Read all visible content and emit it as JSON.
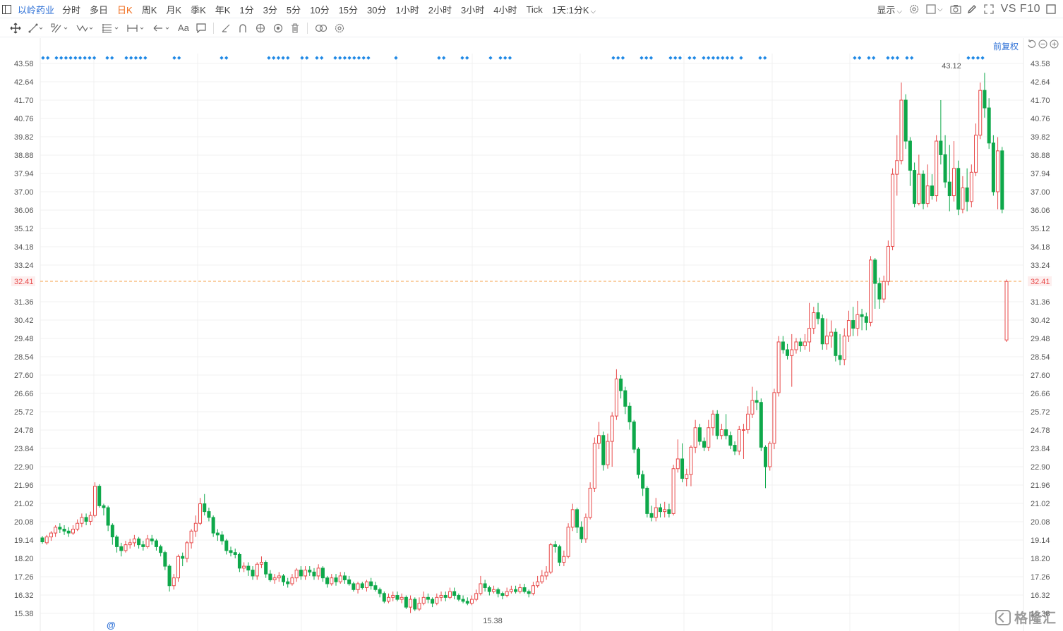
{
  "topbar": {
    "stock_name": "以岭药业",
    "tabs": [
      "分时",
      "多日",
      "日K",
      "周K",
      "月K",
      "季K",
      "年K",
      "1分",
      "3分",
      "5分",
      "10分",
      "15分",
      "30分",
      "1小时",
      "2小时",
      "3小时",
      "4小时",
      "Tick",
      "1天:1分K"
    ],
    "active_tab": "日K",
    "display_label": "显示",
    "vs_label": "VS",
    "f10_label": "F10"
  },
  "toolbar": {
    "icons": [
      "move-icon",
      "line-icon",
      "channel-icon",
      "wave-icon",
      "fib-icon",
      "measure-icon",
      "arrow-icon",
      "text-icon",
      "note-icon",
      "brush-icon",
      "magnet-icon",
      "visibility-icon",
      "lock-icon",
      "trash-icon",
      "compare-icon",
      "settings-icon"
    ],
    "text_tool_label": "Aa"
  },
  "chart": {
    "adjust_label": "前复权",
    "current_price": 32.41,
    "current_price_label": "32.41",
    "high_label": "43.12",
    "low_label": "15.38",
    "y_ticks": [
      "43.58",
      "42.64",
      "41.70",
      "40.76",
      "39.82",
      "38.88",
      "37.94",
      "37.00",
      "36.06",
      "35.12",
      "34.18",
      "33.24",
      "32.41",
      "31.36",
      "30.42",
      "29.48",
      "28.54",
      "27.60",
      "26.66",
      "25.72",
      "24.78",
      "23.84",
      "22.90",
      "21.96",
      "21.02",
      "20.08",
      "19.14",
      "18.20",
      "17.26",
      "16.32",
      "15.38"
    ],
    "colors": {
      "up": "#e84a4a",
      "down": "#0ea84a",
      "price_line": "#f5a04a",
      "price_label": "#e84a4a",
      "marker": "#1e88e5",
      "grid": "#f0f0f0",
      "axis_text": "#555"
    },
    "marker_glyph": "◆"
  },
  "chart_data": {
    "type": "candlestick",
    "title": "以岭药业 日K",
    "y_range": [
      15.38,
      43.58
    ],
    "candles": [
      [
        19.25,
        19.05,
        19.35,
        18.95
      ],
      [
        19.0,
        19.3,
        19.4,
        18.9
      ],
      [
        19.3,
        19.5,
        19.6,
        19.1
      ],
      [
        19.5,
        19.8,
        19.9,
        19.3
      ],
      [
        19.8,
        19.7,
        20.0,
        19.5
      ],
      [
        19.7,
        19.6,
        19.9,
        19.4
      ],
      [
        19.6,
        19.5,
        19.8,
        19.3
      ],
      [
        19.5,
        19.7,
        19.9,
        19.4
      ],
      [
        19.7,
        20.0,
        20.2,
        19.6
      ],
      [
        20.0,
        20.3,
        20.5,
        19.8
      ],
      [
        20.3,
        20.1,
        20.5,
        19.9
      ],
      [
        20.1,
        20.4,
        20.6,
        19.9
      ],
      [
        20.4,
        21.9,
        22.1,
        20.3
      ],
      [
        21.9,
        20.9,
        22.0,
        20.8
      ],
      [
        20.9,
        20.8,
        21.0,
        20.4
      ],
      [
        20.8,
        19.9,
        20.9,
        19.6
      ],
      [
        19.9,
        19.3,
        20.0,
        18.9
      ],
      [
        19.3,
        18.8,
        19.4,
        18.5
      ],
      [
        18.8,
        18.6,
        19.0,
        18.3
      ],
      [
        18.6,
        18.9,
        19.1,
        18.5
      ],
      [
        18.9,
        19.0,
        19.2,
        18.7
      ],
      [
        19.0,
        19.2,
        19.4,
        18.8
      ],
      [
        19.2,
        18.9,
        19.3,
        18.7
      ],
      [
        18.9,
        18.8,
        19.1,
        18.6
      ],
      [
        18.8,
        19.2,
        19.4,
        18.7
      ],
      [
        19.2,
        19.1,
        19.4,
        18.9
      ],
      [
        19.1,
        18.8,
        19.2,
        18.6
      ],
      [
        18.8,
        18.5,
        18.9,
        18.3
      ],
      [
        18.5,
        17.8,
        18.6,
        17.6
      ],
      [
        17.8,
        16.8,
        17.9,
        16.5
      ],
      [
        16.8,
        17.2,
        17.4,
        16.6
      ],
      [
        17.2,
        18.3,
        18.4,
        17.0
      ],
      [
        18.3,
        18.2,
        18.5,
        17.8
      ],
      [
        18.2,
        19.0,
        19.1,
        18.0
      ],
      [
        19.0,
        19.6,
        19.7,
        18.7
      ],
      [
        19.6,
        20.0,
        20.4,
        19.3
      ],
      [
        20.0,
        21.0,
        21.3,
        19.9
      ],
      [
        21.0,
        20.6,
        21.5,
        20.4
      ],
      [
        20.6,
        20.3,
        20.8,
        20.1
      ],
      [
        20.3,
        19.5,
        20.4,
        19.3
      ],
      [
        19.5,
        19.4,
        19.7,
        19.1
      ],
      [
        19.4,
        19.1,
        19.6,
        18.9
      ],
      [
        19.1,
        18.6,
        19.2,
        18.4
      ],
      [
        18.6,
        18.5,
        18.8,
        18.3
      ],
      [
        18.5,
        18.4,
        18.7,
        18.2
      ],
      [
        18.4,
        17.7,
        18.5,
        17.5
      ],
      [
        17.7,
        17.8,
        18.0,
        17.5
      ],
      [
        17.8,
        17.6,
        18.0,
        17.3
      ],
      [
        17.6,
        17.3,
        17.8,
        17.1
      ],
      [
        17.3,
        17.9,
        18.0,
        17.1
      ],
      [
        17.9,
        18.0,
        18.3,
        17.7
      ],
      [
        18.0,
        17.4,
        18.1,
        17.2
      ],
      [
        17.4,
        17.1,
        17.6,
        17.0
      ],
      [
        17.1,
        17.2,
        17.4,
        16.9
      ],
      [
        17.2,
        17.3,
        17.5,
        17.0
      ],
      [
        17.3,
        17.0,
        17.4,
        16.8
      ],
      [
        17.0,
        16.9,
        17.2,
        16.7
      ],
      [
        16.9,
        17.2,
        17.4,
        16.8
      ],
      [
        17.2,
        17.6,
        17.7,
        17.0
      ],
      [
        17.6,
        17.3,
        17.8,
        17.1
      ],
      [
        17.3,
        17.6,
        17.8,
        17.1
      ],
      [
        17.6,
        17.5,
        17.8,
        17.3
      ],
      [
        17.5,
        17.3,
        17.7,
        17.1
      ],
      [
        17.3,
        17.7,
        17.9,
        17.1
      ],
      [
        17.7,
        17.2,
        17.8,
        17.0
      ],
      [
        17.2,
        16.9,
        17.3,
        16.7
      ],
      [
        16.9,
        17.2,
        17.4,
        16.8
      ],
      [
        17.2,
        17.0,
        17.4,
        16.8
      ],
      [
        17.0,
        17.3,
        17.5,
        16.9
      ],
      [
        17.3,
        17.1,
        17.5,
        16.9
      ],
      [
        17.1,
        16.9,
        17.3,
        16.8
      ],
      [
        16.9,
        16.6,
        17.0,
        16.5
      ],
      [
        16.6,
        16.9,
        17.0,
        16.4
      ],
      [
        16.9,
        16.7,
        17.0,
        16.6
      ],
      [
        16.7,
        17.0,
        17.1,
        16.5
      ],
      [
        17.0,
        16.8,
        17.2,
        16.6
      ],
      [
        16.8,
        16.6,
        17.0,
        16.5
      ],
      [
        16.6,
        16.4,
        16.7,
        16.2
      ],
      [
        16.4,
        16.0,
        16.5,
        15.9
      ],
      [
        16.0,
        16.2,
        16.4,
        15.9
      ],
      [
        16.2,
        16.3,
        16.5,
        16.0
      ],
      [
        16.3,
        16.1,
        16.5,
        16.0
      ],
      [
        16.1,
        16.2,
        16.4,
        15.9
      ],
      [
        16.2,
        15.7,
        16.3,
        15.6
      ],
      [
        15.7,
        16.1,
        16.3,
        15.4
      ],
      [
        16.1,
        15.6,
        16.2,
        15.5
      ],
      [
        15.6,
        15.9,
        16.2,
        15.5
      ],
      [
        15.9,
        16.2,
        16.5,
        15.8
      ],
      [
        16.2,
        16.1,
        16.4,
        15.9
      ],
      [
        16.1,
        15.9,
        16.2,
        15.7
      ],
      [
        15.9,
        16.2,
        16.4,
        15.8
      ],
      [
        16.2,
        16.3,
        16.5,
        16.0
      ],
      [
        16.3,
        16.2,
        16.5,
        16.0
      ],
      [
        16.2,
        16.5,
        16.7,
        16.1
      ],
      [
        16.5,
        16.3,
        16.7,
        16.1
      ],
      [
        16.3,
        16.1,
        16.4,
        16.0
      ],
      [
        16.1,
        16.0,
        16.3,
        15.9
      ],
      [
        16.0,
        15.9,
        16.2,
        15.8
      ],
      [
        15.9,
        16.1,
        16.3,
        15.8
      ],
      [
        16.1,
        16.4,
        16.6,
        16.0
      ],
      [
        16.4,
        16.9,
        17.3,
        16.3
      ],
      [
        16.9,
        16.7,
        17.1,
        16.5
      ],
      [
        16.7,
        16.5,
        16.8,
        16.3
      ],
      [
        16.5,
        16.6,
        16.8,
        16.4
      ],
      [
        16.6,
        16.4,
        16.7,
        16.2
      ],
      [
        16.4,
        16.3,
        16.5,
        16.1
      ],
      [
        16.3,
        16.5,
        16.7,
        16.2
      ],
      [
        16.5,
        16.6,
        16.8,
        16.4
      ],
      [
        16.6,
        16.5,
        16.8,
        16.4
      ],
      [
        16.5,
        16.7,
        16.9,
        16.4
      ],
      [
        16.7,
        16.5,
        16.9,
        16.4
      ],
      [
        16.5,
        16.4,
        16.6,
        16.2
      ],
      [
        16.4,
        16.8,
        17.0,
        16.3
      ],
      [
        16.8,
        17.0,
        17.3,
        16.7
      ],
      [
        17.0,
        17.3,
        17.6,
        16.9
      ],
      [
        17.3,
        17.5,
        17.8,
        17.1
      ],
      [
        17.5,
        18.9,
        19.0,
        17.4
      ],
      [
        18.9,
        18.8,
        19.1,
        18.5
      ],
      [
        18.8,
        18.0,
        18.9,
        17.8
      ],
      [
        18.0,
        18.3,
        18.6,
        17.8
      ],
      [
        18.3,
        19.8,
        20.0,
        18.2
      ],
      [
        19.8,
        20.7,
        21.0,
        19.6
      ],
      [
        20.7,
        19.8,
        20.8,
        19.5
      ],
      [
        19.8,
        19.2,
        20.1,
        19.0
      ],
      [
        19.2,
        20.3,
        20.5,
        19.0
      ],
      [
        20.3,
        21.8,
        22.1,
        20.2
      ],
      [
        21.8,
        24.1,
        24.4,
        21.6
      ],
      [
        24.1,
        24.5,
        25.2,
        23.8
      ],
      [
        24.5,
        23.0,
        24.7,
        22.7
      ],
      [
        23.0,
        24.2,
        24.6,
        22.8
      ],
      [
        24.2,
        25.5,
        25.7,
        22.9
      ],
      [
        25.5,
        27.4,
        27.9,
        25.3
      ],
      [
        27.4,
        26.8,
        27.6,
        26.4
      ],
      [
        26.8,
        26.0,
        27.0,
        25.6
      ],
      [
        26.0,
        25.2,
        26.2,
        24.8
      ],
      [
        25.2,
        23.8,
        25.3,
        23.6
      ],
      [
        23.8,
        22.5,
        23.9,
        22.3
      ],
      [
        22.5,
        21.8,
        22.7,
        21.4
      ],
      [
        21.8,
        20.5,
        21.9,
        20.3
      ],
      [
        20.5,
        20.3,
        20.9,
        20.1
      ],
      [
        20.3,
        20.8,
        21.3,
        20.1
      ],
      [
        20.8,
        20.6,
        21.0,
        20.3
      ],
      [
        20.6,
        20.7,
        21.1,
        20.3
      ],
      [
        20.7,
        20.5,
        21.0,
        20.3
      ],
      [
        20.5,
        22.8,
        23.0,
        20.4
      ],
      [
        22.8,
        23.3,
        24.3,
        22.6
      ],
      [
        23.3,
        22.3,
        24.1,
        22.1
      ],
      [
        22.3,
        22.5,
        22.8,
        21.9
      ],
      [
        22.5,
        23.9,
        24.0,
        21.9
      ],
      [
        23.9,
        24.9,
        25.3,
        23.6
      ],
      [
        24.9,
        24.2,
        25.1,
        24.0
      ],
      [
        24.2,
        23.9,
        24.4,
        23.7
      ],
      [
        23.9,
        24.9,
        25.3,
        23.7
      ],
      [
        24.9,
        25.6,
        25.8,
        24.5
      ],
      [
        25.6,
        24.5,
        25.8,
        24.3
      ],
      [
        24.5,
        24.8,
        25.1,
        24.3
      ],
      [
        24.8,
        24.5,
        25.6,
        24.3
      ],
      [
        24.5,
        24.0,
        24.7,
        23.8
      ],
      [
        24.0,
        23.7,
        24.2,
        23.5
      ],
      [
        23.7,
        24.8,
        25.0,
        23.5
      ],
      [
        24.8,
        24.8,
        25.1,
        23.3
      ],
      [
        24.8,
        25.6,
        26.0,
        24.6
      ],
      [
        25.6,
        26.3,
        27.0,
        25.4
      ],
      [
        26.3,
        26.2,
        26.8,
        25.8
      ],
      [
        26.2,
        23.9,
        26.4,
        23.7
      ],
      [
        23.9,
        22.9,
        24.0,
        21.8
      ],
      [
        22.9,
        24.1,
        24.2,
        22.7
      ],
      [
        24.1,
        26.7,
        26.9,
        23.8
      ],
      [
        26.7,
        29.3,
        29.6,
        26.5
      ],
      [
        29.3,
        28.9,
        29.6,
        28.7
      ],
      [
        28.9,
        28.6,
        29.2,
        28.4
      ],
      [
        28.6,
        28.9,
        29.7,
        27.0
      ],
      [
        28.9,
        29.3,
        29.5,
        28.7
      ],
      [
        29.3,
        29.1,
        29.5,
        28.8
      ],
      [
        29.1,
        29.3,
        29.7,
        28.9
      ],
      [
        29.3,
        30.0,
        31.3,
        28.8
      ],
      [
        30.0,
        30.8,
        31.1,
        29.7
      ],
      [
        30.8,
        30.5,
        31.3,
        30.2
      ],
      [
        30.5,
        29.2,
        30.7,
        28.9
      ],
      [
        29.2,
        29.6,
        30.5,
        28.9
      ],
      [
        29.6,
        29.8,
        30.4,
        29.0
      ],
      [
        29.8,
        28.6,
        30.0,
        28.3
      ],
      [
        28.6,
        28.4,
        29.7,
        28.1
      ],
      [
        28.4,
        29.6,
        30.0,
        28.1
      ],
      [
        29.6,
        30.4,
        30.9,
        29.3
      ],
      [
        30.4,
        30.0,
        31.1,
        29.6
      ],
      [
        30.0,
        30.7,
        31.4,
        29.6
      ],
      [
        30.7,
        30.6,
        31.0,
        29.9
      ],
      [
        30.6,
        30.3,
        30.8,
        29.9
      ],
      [
        30.3,
        33.5,
        33.7,
        30.1
      ],
      [
        33.5,
        32.3,
        33.6,
        31.0
      ],
      [
        32.3,
        31.5,
        32.6,
        31.0
      ],
      [
        31.5,
        32.4,
        32.7,
        31.3
      ],
      [
        32.4,
        34.2,
        34.5,
        32.2
      ],
      [
        34.2,
        37.9,
        38.2,
        34.0
      ],
      [
        37.9,
        38.6,
        39.9,
        36.8
      ],
      [
        38.6,
        41.7,
        42.6,
        38.4
      ],
      [
        41.7,
        39.6,
        42.0,
        39.2
      ],
      [
        39.6,
        38.1,
        39.8,
        37.3
      ],
      [
        38.1,
        36.4,
        38.5,
        36.2
      ],
      [
        36.4,
        37.9,
        38.9,
        36.3
      ],
      [
        37.9,
        36.4,
        38.1,
        36.1
      ],
      [
        36.4,
        37.3,
        38.4,
        36.2
      ],
      [
        37.3,
        36.8,
        37.9,
        36.6
      ],
      [
        36.8,
        39.6,
        39.9,
        36.5
      ],
      [
        39.6,
        38.9,
        41.7,
        38.4
      ],
      [
        38.9,
        37.5,
        39.9,
        37.2
      ],
      [
        37.5,
        36.8,
        39.4,
        36.0
      ],
      [
        36.8,
        38.2,
        39.6,
        36.5
      ],
      [
        38.2,
        36.1,
        38.6,
        35.8
      ],
      [
        36.1,
        37.2,
        37.8,
        35.9
      ],
      [
        37.2,
        36.5,
        38.2,
        36.0
      ],
      [
        36.5,
        38.0,
        38.4,
        36.2
      ],
      [
        38.0,
        39.9,
        40.5,
        37.8
      ],
      [
        39.9,
        42.2,
        42.6,
        39.7
      ],
      [
        42.2,
        41.3,
        43.1,
        40.8
      ],
      [
        41.3,
        39.5,
        41.8,
        39.2
      ],
      [
        39.5,
        37.0,
        39.9,
        36.8
      ],
      [
        37.0,
        39.1,
        39.8,
        36.1
      ],
      [
        39.1,
        36.1,
        39.3,
        35.9
      ],
      [
        29.4,
        32.4,
        32.5,
        29.3
      ]
    ],
    "marker_groups": [
      {
        "start": 61,
        "count": 2
      },
      {
        "start": 80,
        "count": 9
      },
      {
        "start": 152,
        "count": 2
      },
      {
        "start": 179,
        "count": 5
      },
      {
        "start": 247,
        "count": 2
      },
      {
        "start": 314,
        "count": 2
      },
      {
        "start": 381,
        "count": 5
      },
      {
        "start": 428,
        "count": 2
      },
      {
        "start": 449,
        "count": 2
      },
      {
        "start": 475,
        "count": 8
      },
      {
        "start": 561,
        "count": 1
      },
      {
        "start": 622,
        "count": 2
      },
      {
        "start": 655,
        "count": 2
      },
      {
        "start": 695,
        "count": 1
      },
      {
        "start": 709,
        "count": 3
      },
      {
        "start": 869,
        "count": 3
      },
      {
        "start": 909,
        "count": 3
      },
      {
        "start": 950,
        "count": 3
      },
      {
        "start": 977,
        "count": 2
      },
      {
        "start": 997,
        "count": 7
      },
      {
        "start": 1050,
        "count": 1
      },
      {
        "start": 1077,
        "count": 2
      },
      {
        "start": 1211,
        "count": 2
      },
      {
        "start": 1231,
        "count": 2
      },
      {
        "start": 1258,
        "count": 3
      },
      {
        "start": 1285,
        "count": 2
      },
      {
        "start": 1372,
        "count": 4
      }
    ]
  }
}
